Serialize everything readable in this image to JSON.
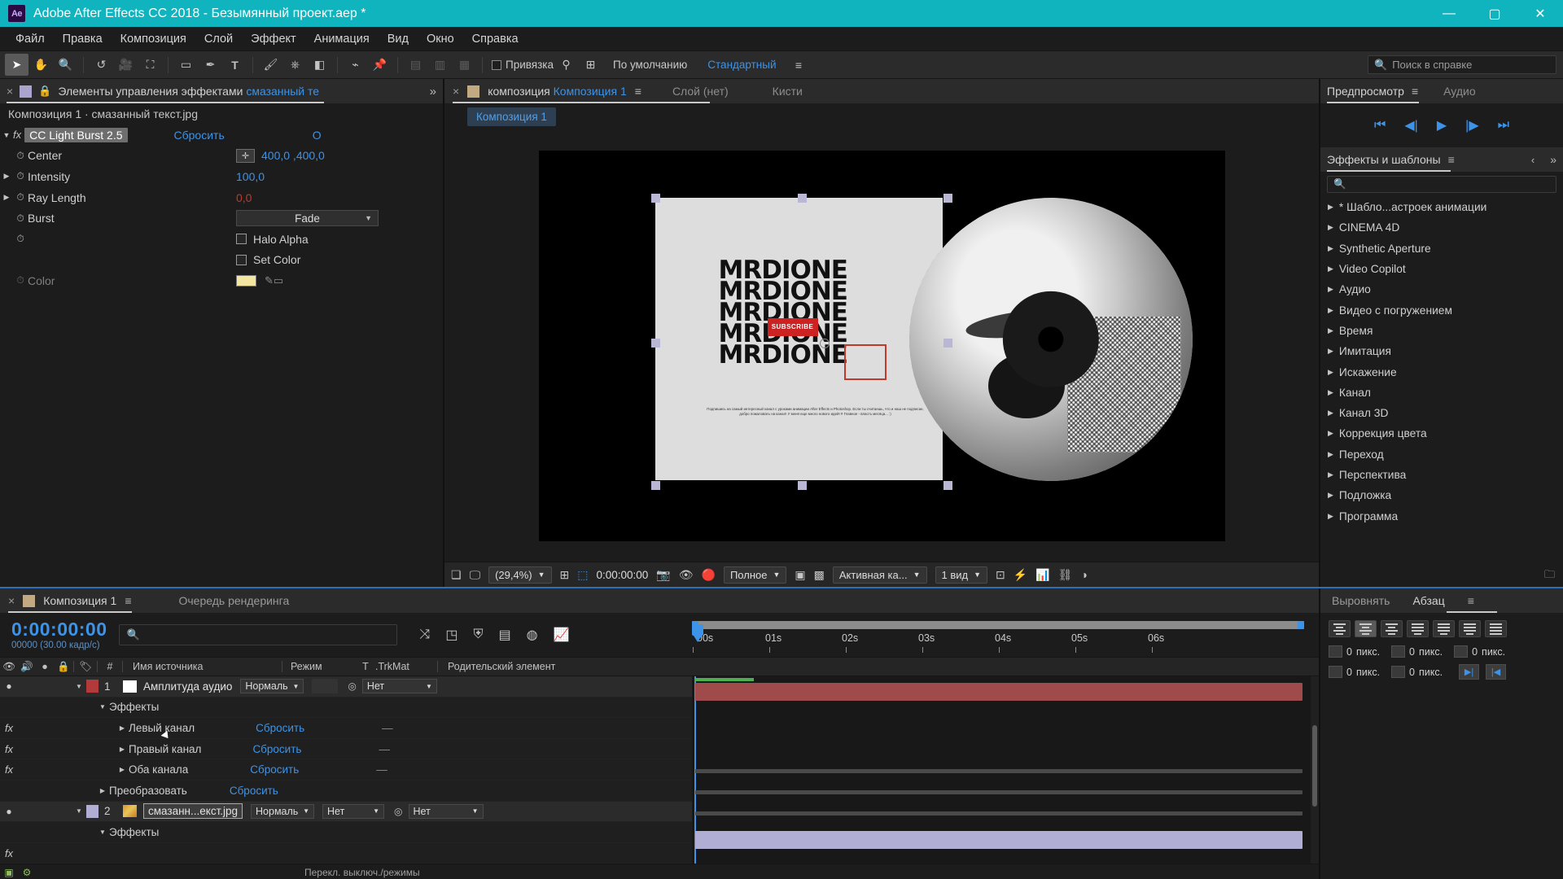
{
  "titlebar": {
    "logo": "Ae",
    "title": "Adobe After Effects CC 2018 - Безымянный проект.aep *",
    "minimize": "—",
    "maximize": "▢",
    "close": "✕"
  },
  "menubar": {
    "items": [
      "Файл",
      "Правка",
      "Композиция",
      "Слой",
      "Эффект",
      "Анимация",
      "Вид",
      "Окно",
      "Справка"
    ]
  },
  "toolbar": {
    "tools": [
      "selection-tool",
      "hand-tool",
      "zoom-tool",
      "rotation-tool",
      "camera-tool",
      "pan-behind-tool",
      "shape-tool",
      "pen-tool",
      "text-tool",
      "brush-tool",
      "clone-stamp-tool",
      "eraser-tool",
      "roto-brush-tool",
      "puppet-pin-tool"
    ],
    "snap_label": "Привязка",
    "workspace_default": "По умолчанию",
    "workspace_standard": "Стандартный",
    "workspace_menu": "≡",
    "overflow": "»",
    "search_placeholder": "Поиск в справке"
  },
  "effect_controls": {
    "tab_title_static": "Элементы управления эффектами",
    "tab_title_link": "смазанный те",
    "subheader": "Композиция 1 · смазанный текст.jpg",
    "effect_name": "CC Light Burst 2.5",
    "reset_label": "Сбросить",
    "about_label": "О",
    "properties": [
      {
        "name": "Center",
        "value": "400,0 ,400,0",
        "type": "point",
        "color": "blue"
      },
      {
        "name": "Intensity",
        "value": "100,0",
        "type": "number",
        "color": "blue"
      },
      {
        "name": "Ray Length",
        "value": "0,0",
        "type": "number",
        "color": "red"
      },
      {
        "name": "Burst",
        "value": "Fade",
        "type": "dropdown"
      },
      {
        "name": "",
        "value": "Halo Alpha",
        "type": "checkbox"
      },
      {
        "name": "",
        "value": "Set Color",
        "type": "checkbox"
      },
      {
        "name": "Color",
        "value": "",
        "type": "color",
        "swatch": "#f2e6a0"
      }
    ]
  },
  "composition_viewer": {
    "tab_static": "композиция",
    "tab_link": "Композиция 1",
    "menu_icon": "≡",
    "tab_layer": "Слой (нет)",
    "tab_brushes": "Кисти",
    "breadcrumb": "Композиция 1",
    "poster": {
      "lines": [
        "MRDIONE",
        "MRDIONE",
        "MRDIONE",
        "MRDIONE",
        "MRDIONE"
      ],
      "badge": "SUBSCRIBE",
      "caption": "Подпишись на самый интересный канал с уроками анимации After Effects и Photoshop. Если ты считаешь, что и наш не подписан, добро пожаловать на канал! У меня еще много нового идей! # Главное - власть месяца... :)"
    },
    "toolbar": {
      "zoom_level": "(29,4%)",
      "timecode": "0:00:00:00",
      "resolution": "Полное",
      "view_camera": "Активная ка...",
      "views": "1 вид"
    }
  },
  "preview_panel": {
    "title": "Предпросмотр",
    "menu": "≡",
    "audio_tab": "Аудио",
    "buttons": [
      "first-frame",
      "prev-frame",
      "play",
      "next-frame",
      "last-frame"
    ]
  },
  "effects_panel": {
    "title": "Эффекты и шаблоны",
    "menu": "≡",
    "search_placeholder": "",
    "items": [
      "* Шабло...астроек анимации",
      "CINEMA 4D",
      "Synthetic Aperture",
      "Video Copilot",
      "Аудио",
      "Видео с погружением",
      "Время",
      "Имитация",
      "Искажение",
      "Канал",
      "Канал 3D",
      "Коррекция цвета",
      "Переход",
      "Перспектива",
      "Подложка",
      "Программа"
    ]
  },
  "timeline": {
    "tab_comp": "Композиция 1",
    "tab_render": "Очередь рендеринга",
    "menu": "≡",
    "timecode": "0:00:00:00",
    "frame_info": "00000 (30.00 кадр/c)",
    "search_placeholder": "",
    "columns": [
      "Имя источника",
      "Режим",
      "T",
      ".TrkMat",
      "Родительский элемент"
    ],
    "ruler_labels": [
      "00s",
      "01s",
      "02s",
      "03s",
      "04s",
      "05s",
      "06s"
    ],
    "rows": [
      {
        "kind": "layer",
        "visible": "●",
        "index": "1",
        "color": "#b33a3a",
        "name": "Амплитуда аудио",
        "mode": "Нормаль",
        "parent": "Нет",
        "bar": "red"
      },
      {
        "kind": "group",
        "label": "Эффекты",
        "indent": 2
      },
      {
        "kind": "effect",
        "label": "Левый канал",
        "reset": "Сбросить",
        "dash": "—",
        "indent": 3
      },
      {
        "kind": "effect",
        "label": "Правый канал",
        "reset": "Сбросить",
        "dash": "—",
        "indent": 3
      },
      {
        "kind": "effect",
        "label": "Оба канала",
        "reset": "Сбросить",
        "dash": "—",
        "indent": 3
      },
      {
        "kind": "group",
        "label": "Преобразовать",
        "reset": "Сбросить",
        "indent": 2
      },
      {
        "kind": "layer",
        "visible": "●",
        "index": "2",
        "color": "#b1aed6",
        "name": "смазанн...екст.jpg",
        "mode": "Нормаль",
        "trkmat": "Нет",
        "parent": "Нет",
        "bar": "lav",
        "boxed": true
      },
      {
        "kind": "group",
        "label": "Эффекты",
        "indent": 2
      }
    ],
    "footer_label": "Перекл. выключ./режимы"
  },
  "align_panel": {
    "title": "Выровнять",
    "paragraph_title": "Абзац",
    "menu": "≡",
    "align_buttons": [
      "align-left",
      "align-center",
      "align-right",
      "justify-last-left",
      "justify-last-center",
      "justify-last-right",
      "justify-all"
    ],
    "fields": [
      {
        "icon": "indent-left",
        "value": "0",
        "unit": "пикс."
      },
      {
        "icon": "indent-right",
        "value": "0",
        "unit": "пикс."
      },
      {
        "icon": "indent-first",
        "value": "0",
        "unit": "пикс."
      },
      {
        "icon": "space-before",
        "value": "0",
        "unit": "пикс."
      },
      {
        "icon": "space-after",
        "value": "0",
        "unit": "пикс."
      }
    ],
    "direction_buttons": [
      "ltr-text",
      "rtl-text"
    ]
  },
  "colors": {
    "accent_teal": "#10b4bf",
    "link_blue": "#3d93e8",
    "warn_red": "#c0392b",
    "panel_bg": "#1c1c1c",
    "tab_bg": "#2b2b2b"
  }
}
